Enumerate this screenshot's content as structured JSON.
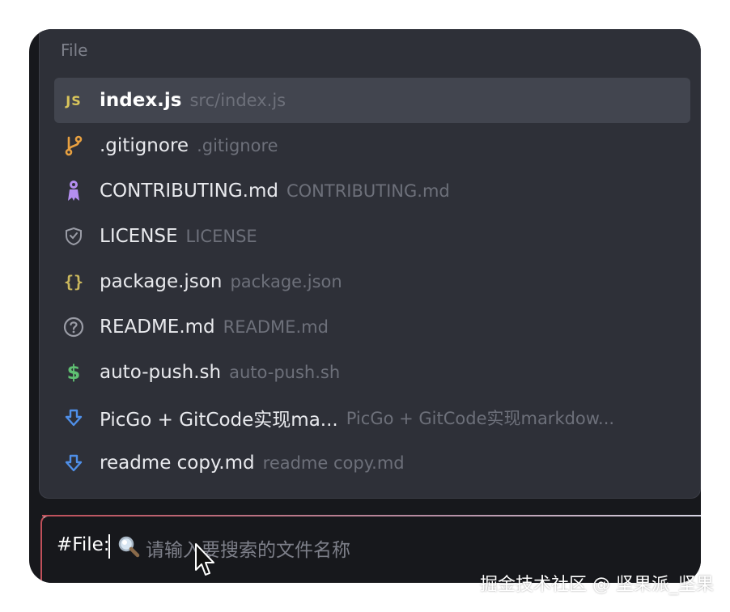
{
  "popup": {
    "section_label": "File",
    "items": [
      {
        "name": "index.js",
        "path": "src/index.js",
        "icon": "js-icon",
        "selected": true
      },
      {
        "name": ".gitignore",
        "path": ".gitignore",
        "icon": "git-branch-icon"
      },
      {
        "name": "CONTRIBUTING.md",
        "path": "CONTRIBUTING.md",
        "icon": "contributing-icon"
      },
      {
        "name": "LICENSE",
        "path": "LICENSE",
        "icon": "shield-icon"
      },
      {
        "name": "package.json",
        "path": "package.json",
        "icon": "json-braces-icon"
      },
      {
        "name": "README.md",
        "path": "README.md",
        "icon": "question-circle-icon"
      },
      {
        "name": "auto-push.sh",
        "path": "auto-push.sh",
        "icon": "dollar-icon"
      },
      {
        "name": "PicGo + GitCode实现ma...",
        "path": "PicGo + GitCode实现markdow...",
        "icon": "download-arrow-icon"
      },
      {
        "name": "readme copy.md",
        "path": "readme copy.md",
        "icon": "download-arrow-icon"
      }
    ]
  },
  "input": {
    "prefix": "#File:",
    "placeholder": "请输入要搜索的文件名称"
  },
  "watermark": "掘金技术社区 @ 坚果派_坚果",
  "colors": {
    "background": "#17181c",
    "popup": "#2e3038",
    "selected": "#42454f",
    "js": "#d9c55b",
    "git": "#e8a040",
    "contributing": "#b48ef0",
    "json": "#cbb85d",
    "shell": "#5fbf72",
    "markdown_arrow": "#4f8fe8"
  }
}
